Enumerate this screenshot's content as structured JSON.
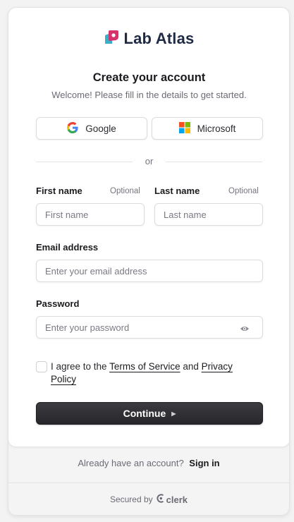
{
  "brand": {
    "name": "Lab Atlas",
    "accent": "#d6336c",
    "secondary": "#37b0c9"
  },
  "header": {
    "title": "Create your account",
    "subtitle": "Welcome! Please fill in the details to get started."
  },
  "social": {
    "google_label": "Google",
    "microsoft_label": "Microsoft"
  },
  "divider": {
    "text": "or"
  },
  "form": {
    "first_name": {
      "label": "First name",
      "optional": "Optional",
      "placeholder": "First name"
    },
    "last_name": {
      "label": "Last name",
      "optional": "Optional",
      "placeholder": "Last name"
    },
    "email": {
      "label": "Email address",
      "placeholder": "Enter your email address"
    },
    "password": {
      "label": "Password",
      "placeholder": "Enter your password"
    },
    "terms": {
      "prefix": "I agree to the",
      "terms_link": "Terms of Service",
      "middle": "and",
      "privacy_link": "Privacy Policy",
      "checked": false
    },
    "submit_label": "Continue"
  },
  "footer": {
    "signin_prompt": "Already have an account?",
    "signin_link": "Sign in",
    "secured_by": "Secured by",
    "provider": "clerk"
  }
}
